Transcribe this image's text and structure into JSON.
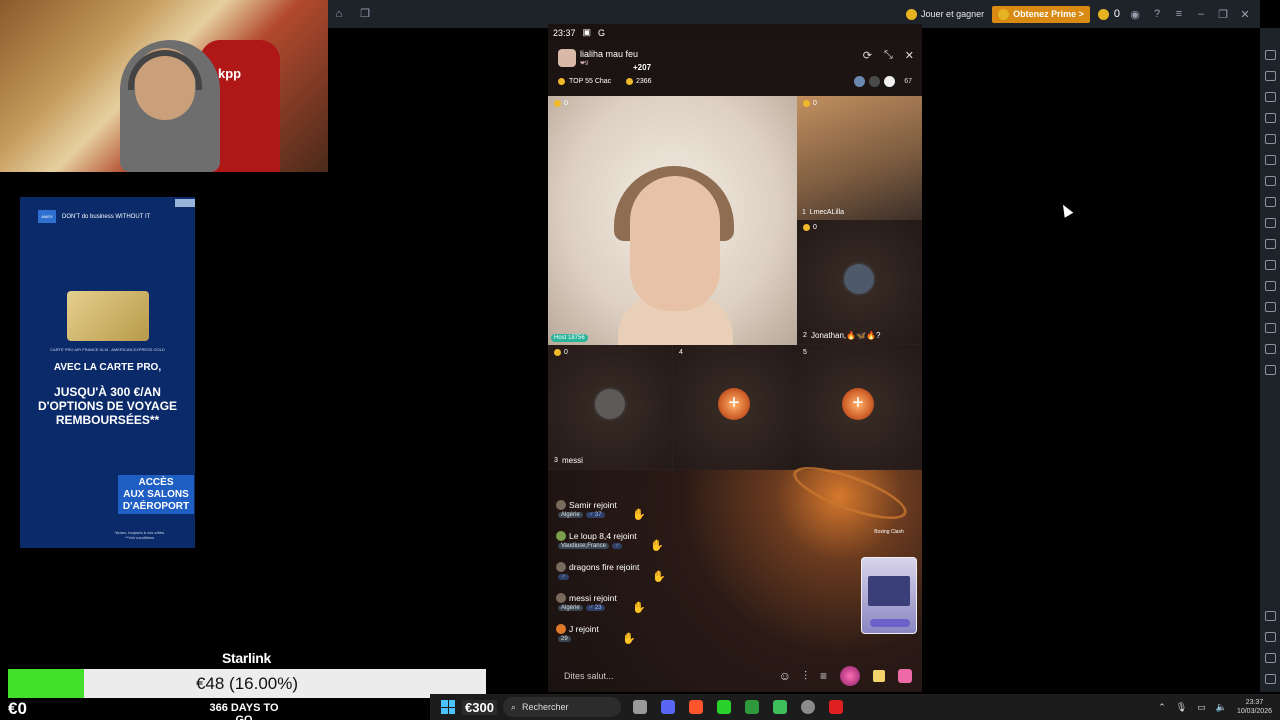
{
  "emulator": {
    "topbar": {
      "play_label": "Jouer et gagner",
      "prime_label": "Obtenez Prime >",
      "coin_count": "0"
    }
  },
  "webcam": {
    "jersey_text": "kpp"
  },
  "ad": {
    "brand_tagline": "DON'T do business WITHOUT IT",
    "card_caption": "CARTE PRO AIR FRANCE KLM - AMERICAN EXPRESS GOLD",
    "subline": "AVEC LA CARTE PRO,",
    "headline": "JUSQU'À 300 €/AN\nD'OPTIONS DE VOYAGE\nREMBOURSÉES**",
    "cta": "ACCÈS\nAUX SALONS\nD'AÉROPORT",
    "fine_print": "*Amex, toujours à vos côtés.\n**Voir conditions"
  },
  "overlay": {
    "starlink_label": "Starlink",
    "progress_text": "€48 (16.00%)",
    "progress_fraction": 0.16,
    "start_amount": "€0",
    "days_label": "366 DAYS TO GO",
    "accent_color": "#42e02b"
  },
  "phone": {
    "status_time": "23:37",
    "host": {
      "name": "lialiha mau feu",
      "sub": "❤9",
      "gain": "+207",
      "rank": "TOP 55 Chac",
      "coins": "2366",
      "viewer_count": "67"
    },
    "seats": [
      {
        "num": "",
        "name": "Host 18756",
        "score": "0"
      },
      {
        "num": "1",
        "name": "LmecALilla",
        "score": "0"
      },
      {
        "num": "2",
        "name": "Jonathan,🔥🦋🔥?",
        "score": "0"
      },
      {
        "num": "3",
        "name": "messi",
        "score": "0"
      },
      {
        "num": "4",
        "name": "",
        "score": ""
      },
      {
        "num": "5",
        "name": "",
        "score": ""
      }
    ],
    "chat": [
      {
        "text": "Samir rejoint",
        "loc": "Algérie",
        "gender": "♂ 37"
      },
      {
        "text": "Le loup 8,4 rejoint",
        "loc": "Vaudiuse,France",
        "gender": "♂"
      },
      {
        "text": "dragons fire rejoint",
        "loc": "",
        "gender": "♂"
      },
      {
        "text": "messi rejoint",
        "loc": "Algérie",
        "gender": "♂ 23"
      },
      {
        "text": "J rejoint",
        "loc": "",
        "gender": "29"
      }
    ],
    "game_label": "Boxing Clash",
    "input_placeholder": "Dites salut..."
  },
  "taskbar": {
    "weather": "€300",
    "search_label": "Rechercher",
    "clock_time": "23:37",
    "clock_date": "10/03/2026"
  }
}
